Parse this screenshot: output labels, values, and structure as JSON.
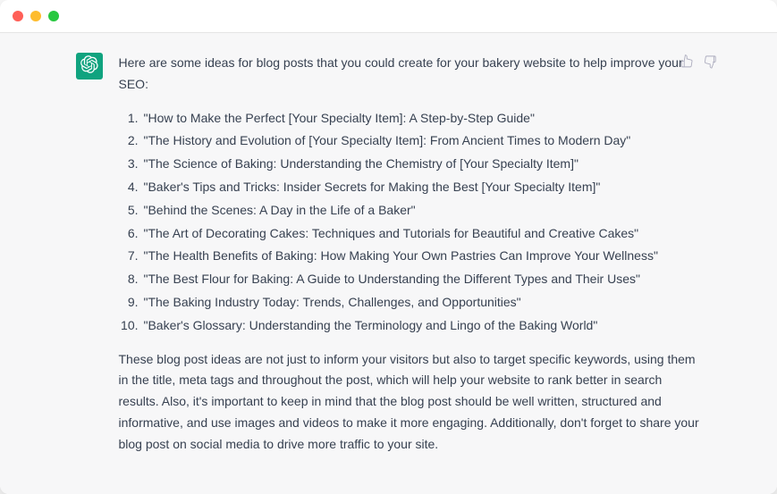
{
  "message": {
    "intro": "Here are some ideas for blog posts that you could create for your bakery website to help improve your SEO:",
    "list": [
      "\"How to Make the Perfect [Your Specialty Item]: A Step-by-Step Guide\"",
      "\"The History and Evolution of [Your Specialty Item]: From Ancient Times to Modern Day\"",
      "\"The Science of Baking: Understanding the Chemistry of [Your Specialty Item]\"",
      "\"Baker's Tips and Tricks: Insider Secrets for Making the Best [Your Specialty Item]\"",
      "\"Behind the Scenes: A Day in the Life of a Baker\"",
      "\"The Art of Decorating Cakes: Techniques and Tutorials for Beautiful and Creative Cakes\"",
      "\"The Health Benefits of Baking: How Making Your Own Pastries Can Improve Your Wellness\"",
      "\"The Best Flour for Baking: A Guide to Understanding the Different Types and Their Uses\"",
      "\"The Baking Industry Today: Trends, Challenges, and Opportunities\"",
      "\"Baker's Glossary: Understanding the Terminology and Lingo of the Baking World\""
    ],
    "outro": "These blog post ideas are not just to inform your visitors but also to target specific keywords, using them in the title, meta tags and throughout the post, which will help your website to rank better in search results. Also, it's important to keep in mind that the blog post should be well written, structured and informative, and use images and videos to make it more engaging. Additionally, don't forget to share your blog post on social media to drive more traffic to your site."
  }
}
